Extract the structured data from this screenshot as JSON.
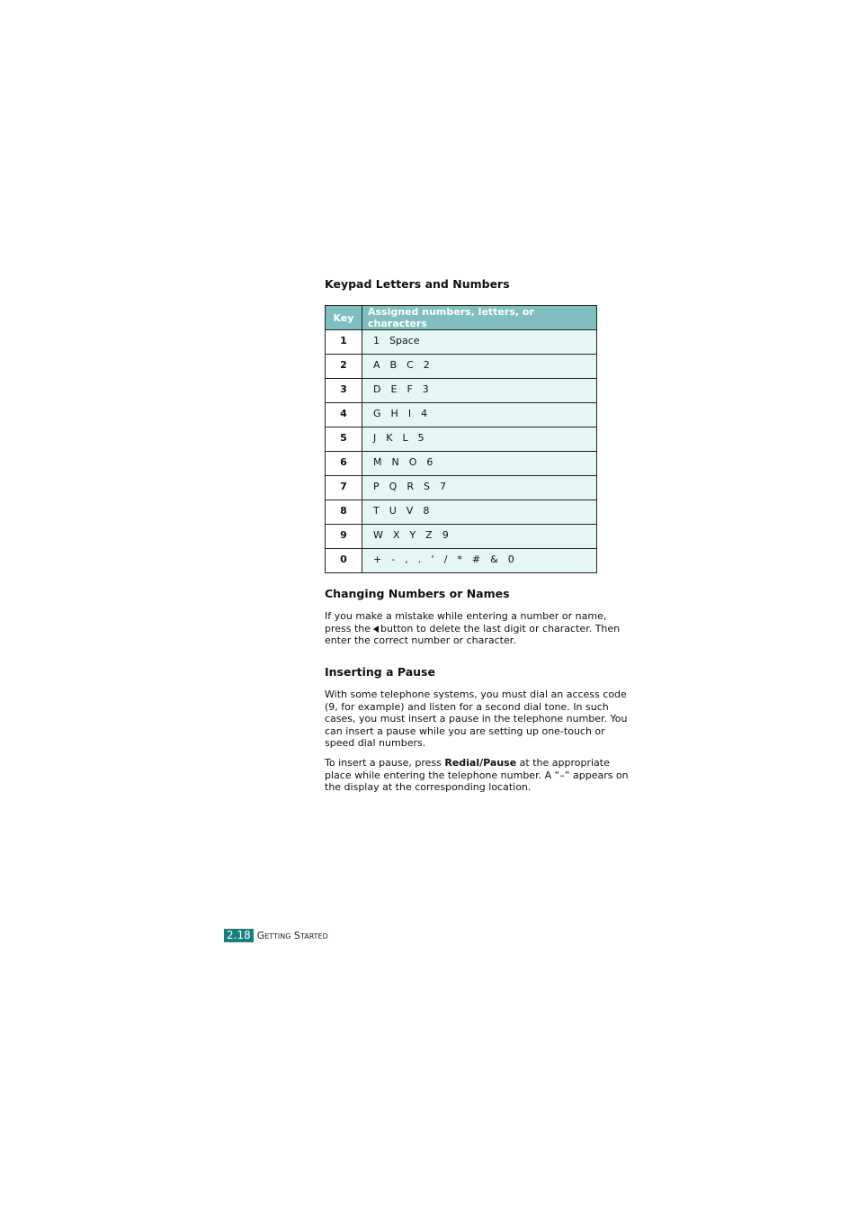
{
  "sections": {
    "keypad": {
      "heading": "Keypad Letters and Numbers",
      "table": {
        "headers": [
          "Key",
          "Assigned numbers, letters, or characters"
        ],
        "rows": [
          {
            "key": "1",
            "chars": [
              "1",
              "Space"
            ]
          },
          {
            "key": "2",
            "chars": [
              "A",
              "B",
              "C",
              "2"
            ]
          },
          {
            "key": "3",
            "chars": [
              "D",
              "E",
              "F",
              "3"
            ]
          },
          {
            "key": "4",
            "chars": [
              "G",
              "H",
              "I",
              "4"
            ]
          },
          {
            "key": "5",
            "chars": [
              "J",
              "K",
              "L",
              "5"
            ]
          },
          {
            "key": "6",
            "chars": [
              "M",
              "N",
              "O",
              "6"
            ]
          },
          {
            "key": "7",
            "chars": [
              "P",
              "Q",
              "R",
              "S",
              "7"
            ]
          },
          {
            "key": "8",
            "chars": [
              "T",
              "U",
              "V",
              "8"
            ]
          },
          {
            "key": "9",
            "chars": [
              "W",
              "X",
              "Y",
              "Z",
              "9"
            ]
          },
          {
            "key": "0",
            "chars": [
              "+",
              "-",
              ",",
              ".",
              "‘",
              "/",
              "*",
              "#",
              "&",
              "0"
            ]
          }
        ]
      }
    },
    "changing": {
      "heading": "Changing Numbers or Names",
      "text_before": "If you make a mistake while entering a number or name, press the",
      "icon": "back-arrow-icon",
      "text_after": "button to delete the last digit or character. Then enter the correct number or character."
    },
    "pause": {
      "heading": "Inserting a Pause",
      "paragraph1": "With some telephone systems, you must dial an access code (9, for example) and listen for a second dial tone. In such cases, you must insert a pause in the telephone number. You can insert a pause while you are setting up one-touch or speed dial numbers.",
      "paragraph2_before": "To insert a pause, press ",
      "paragraph2_bold": "Redial/Pause",
      "paragraph2_after": " at the appropriate place while entering the telephone number. A “–” appears on the display at the corresponding location."
    }
  },
  "footer": {
    "page_number": "2.18",
    "section_name": "Getting Started"
  },
  "colors": {
    "table_header_bg": "#7fbfbf",
    "table_cell_bg": "#e4f7f5",
    "page_badge_bg": "#1a7f7f"
  }
}
